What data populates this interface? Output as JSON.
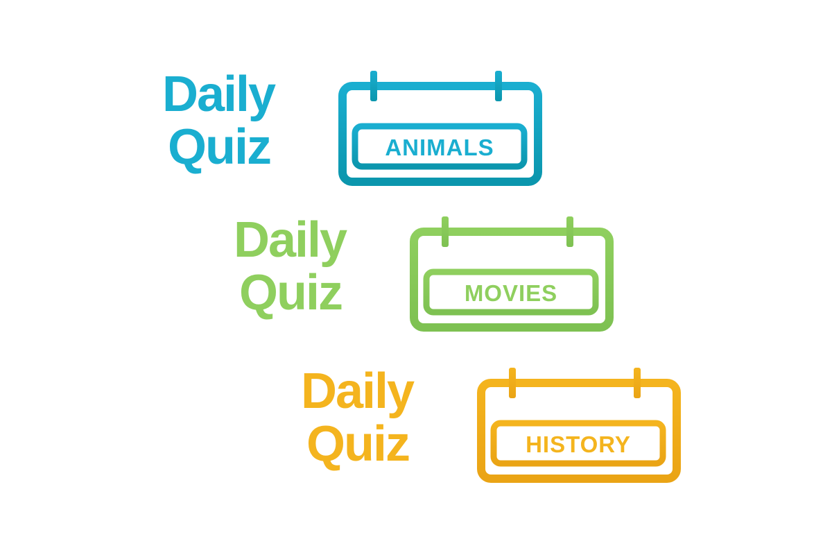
{
  "logos": [
    {
      "line1": "Daily",
      "line2": "Quiz",
      "category": "ANIMALS",
      "color_top": "#1aaed0",
      "color_bottom": "#0b96ad"
    },
    {
      "line1": "Daily",
      "line2": "Quiz",
      "category": "MOVIES",
      "color_top": "#8fcf5e",
      "color_bottom": "#7ec152"
    },
    {
      "line1": "Daily",
      "line2": "Quiz",
      "category": "HISTORY",
      "color_top": "#f4b41e",
      "color_bottom": "#eaa415"
    }
  ],
  "icons": {
    "calendar": "calendar-icon"
  }
}
